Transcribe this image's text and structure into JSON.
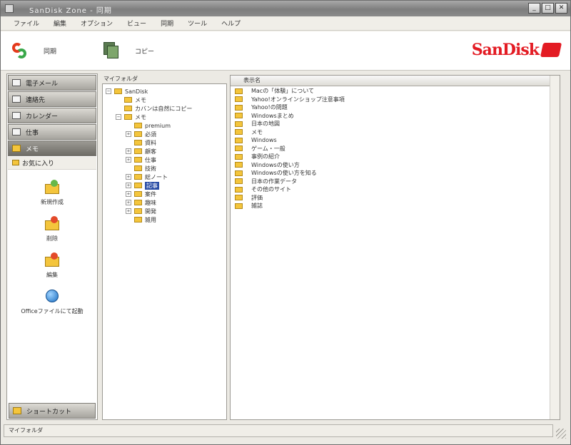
{
  "window": {
    "title": "SanDisk Zone - 同期",
    "controls": [
      "_",
      "□",
      "✕"
    ]
  },
  "menu": [
    "ファイル",
    "編集",
    "オプション",
    "ビュー",
    "同期",
    "ツール",
    "ヘルプ"
  ],
  "toolbar": {
    "sync_label": "同期",
    "copy_label": "コピー",
    "brand": "SanDisk"
  },
  "nav": {
    "buttons": [
      "電子メール",
      "連絡先",
      "カレンダー",
      "仕事",
      "メモ"
    ],
    "sub_item": "お気に入り",
    "tiles": [
      "新規作成",
      "削除",
      "編集",
      "Officeファイルにて起動"
    ],
    "bottom_button": "ショートカット"
  },
  "tree_panel": {
    "caption": "マイフォルダ",
    "nodes": [
      {
        "label": "SanDisk",
        "level": 0,
        "expander": "−"
      },
      {
        "label": "メモ",
        "level": 1,
        "expander": ""
      },
      {
        "label": "カバンは自然にコピー",
        "level": 1,
        "expander": ""
      },
      {
        "label": "メモ",
        "level": 1,
        "expander": "−"
      },
      {
        "label": "premium",
        "level": 2,
        "expander": ""
      },
      {
        "label": "必須",
        "level": 2,
        "expander": "+"
      },
      {
        "label": "資料",
        "level": 2,
        "expander": ""
      },
      {
        "label": "顧客",
        "level": 2,
        "expander": "+"
      },
      {
        "label": "仕事",
        "level": 2,
        "expander": "+"
      },
      {
        "label": "技術",
        "level": 2,
        "expander": ""
      },
      {
        "label": "総ノート",
        "level": 2,
        "expander": "+"
      },
      {
        "label": "記事",
        "level": 2,
        "expander": "+",
        "selected": true
      },
      {
        "label": "案件",
        "level": 2,
        "expander": "+"
      },
      {
        "label": "趣味",
        "level": 2,
        "expander": "+"
      },
      {
        "label": "開発",
        "level": 2,
        "expander": "+"
      },
      {
        "label": "雑用",
        "level": 2,
        "expander": ""
      }
    ]
  },
  "list_panel": {
    "header": "表示名",
    "rows": [
      "Macの「体験」について",
      "Yahoo!オンラインショップ注意事項",
      "Yahoo!の問題",
      "Windowsまとめ",
      "日本の地図",
      "メモ",
      "Windows",
      "ゲーム・一般",
      "事例の紹介",
      "Windowsの使い方",
      "Windowsの使い方を知る",
      "日本の作業データ",
      "その他のサイト",
      "評価",
      "雑誌"
    ]
  },
  "status": {
    "text": "マイフォルダ"
  },
  "colors": {
    "brand_red": "#e31b23",
    "folder_yellow": "#f4c53c",
    "selection_blue": "#2b4ea6"
  }
}
